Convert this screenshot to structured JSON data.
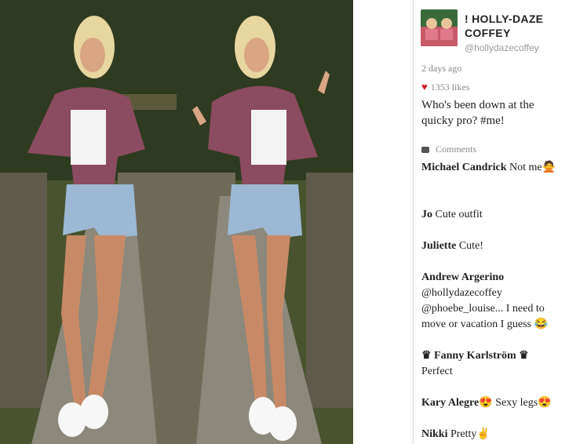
{
  "post": {
    "username": "! HOLLY-DAZE COFFEY",
    "handle": "@hollydazecoffey",
    "time_ago": "2 days ago",
    "likes": "1353 likes",
    "caption": "Who's been down at the quicky pro? #me!"
  },
  "comments_label": "Comments",
  "comments": [
    {
      "author": "Michael Candrick",
      "text": "Not me🙅"
    },
    {
      "author": "Jo",
      "text": "Cute outfit"
    },
    {
      "author": "Juliette",
      "text": "Cute!"
    },
    {
      "author": "Andrew Argerino",
      "text": "@hollydazecoffey @phoebe_louise... I need to move or vacation I guess 😂"
    },
    {
      "author": "♛ Fanny Karlström ♛",
      "text": "Perfect"
    },
    {
      "author": "Kary Alegre😍",
      "text": "Sexy legs😍"
    },
    {
      "author": "Nikki",
      "text": "Pretty✌"
    }
  ],
  "colors": {
    "heart": "#d21f2a",
    "panel_bg": "#ffffff",
    "muted": "#888888"
  },
  "icons": {
    "heart": "heart-icon",
    "comments": "speech-bubble-icon"
  }
}
